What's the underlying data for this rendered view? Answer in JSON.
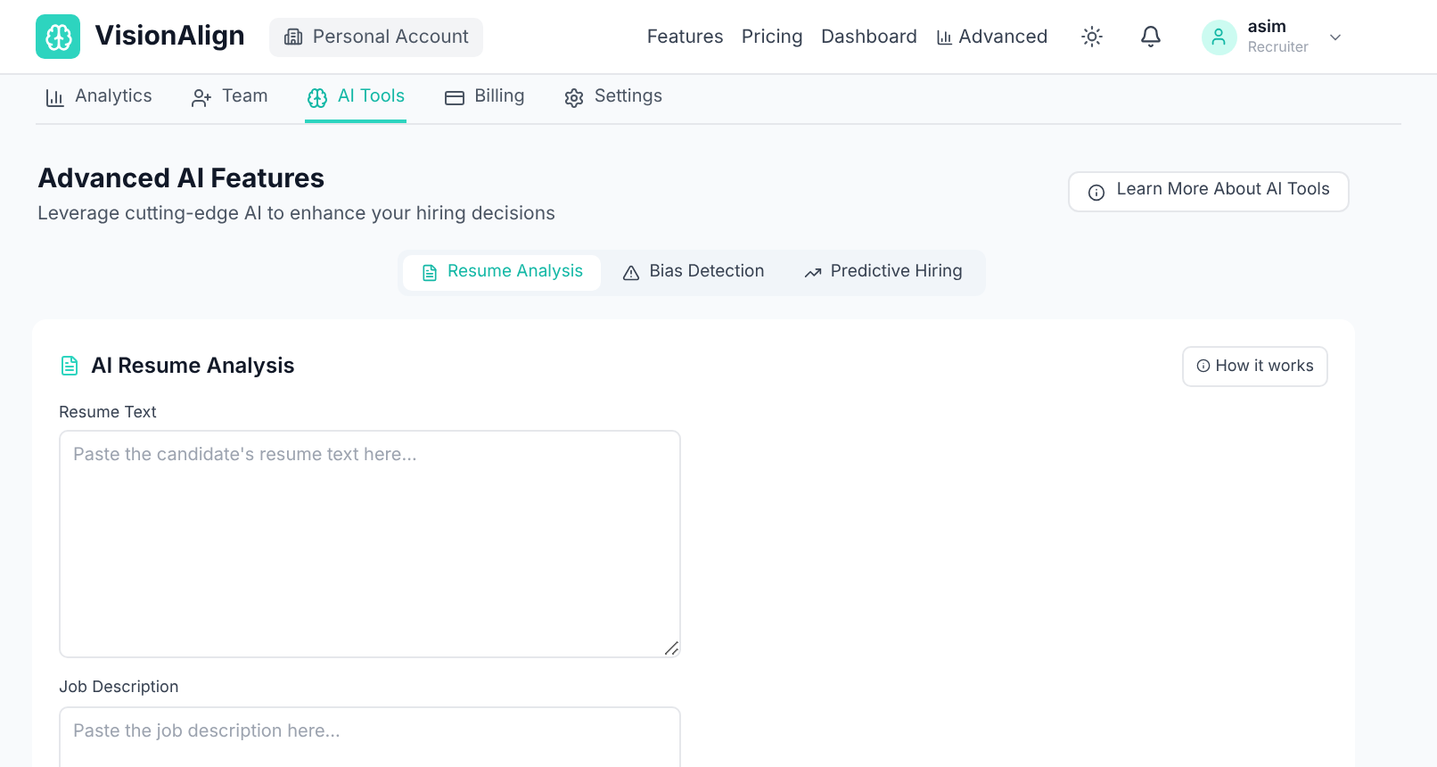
{
  "header": {
    "brand": "VisionAlign",
    "account": "Personal Account",
    "links": [
      {
        "label": "Features",
        "kind": "text"
      },
      {
        "label": "Pricing",
        "kind": "text"
      },
      {
        "label": "Dashboard",
        "kind": "text"
      },
      {
        "label": "Advanced",
        "kind": "chart"
      }
    ],
    "user": {
      "name": "asim",
      "role": "Recruiter"
    }
  },
  "nav_tabs": [
    {
      "label": "Analytics",
      "kind": "chart",
      "selected": false
    },
    {
      "label": "Team",
      "kind": "user-plus",
      "selected": false
    },
    {
      "label": "AI Tools",
      "kind": "brain",
      "selected": true
    },
    {
      "label": "Billing",
      "kind": "card",
      "selected": false
    },
    {
      "label": "Settings",
      "kind": "gear",
      "selected": false
    }
  ],
  "page": {
    "title": "Advanced AI Features",
    "subtitle": "Leverage cutting-edge AI to enhance your hiring decisions",
    "learn_more": "Learn More About AI Tools"
  },
  "feature_tabs": [
    {
      "label": "Resume Analysis",
      "kind": "file",
      "selected": true
    },
    {
      "label": "Bias Detection",
      "kind": "warning",
      "selected": false
    },
    {
      "label": "Predictive Hiring",
      "kind": "trend",
      "selected": false
    }
  ],
  "card": {
    "title": "AI Resume Analysis",
    "how_it_works": "How it works",
    "fields": [
      {
        "label": "Resume Text",
        "placeholder": "Paste the candidate's resume text here..."
      },
      {
        "label": "Job Description",
        "placeholder": "Paste the job description here..."
      }
    ]
  }
}
